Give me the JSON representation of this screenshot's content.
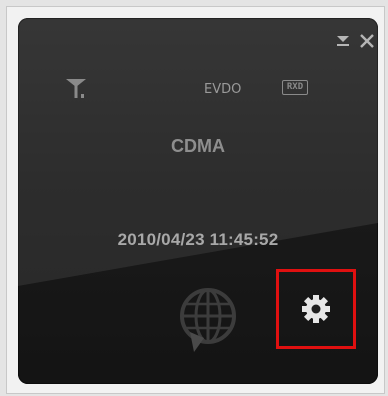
{
  "window": {
    "controls": {
      "minimize_icon": "minimize-icon",
      "close_icon": "close-icon"
    }
  },
  "status": {
    "signal_icon": "signal-antenna-icon",
    "network_type": "EVDO",
    "rx_badge": "RXD"
  },
  "carrier": "CDMA",
  "datetime": "2010/04/23 11:45:52",
  "actions": {
    "globe_icon": "globe-connect-icon",
    "settings_icon": "gear-icon",
    "highlight_color": "#e01010"
  }
}
